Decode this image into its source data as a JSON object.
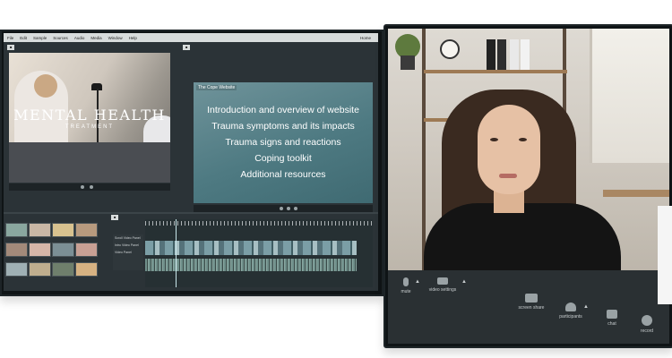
{
  "editor": {
    "menu": [
      "File",
      "Edit",
      "Sample",
      "Sources",
      "Audio",
      "Media",
      "Window",
      "Help"
    ],
    "home_label": "Home",
    "video_preview": {
      "title": "MENTAL HEALTH",
      "subtitle": "TREATMENT"
    },
    "slide": {
      "title": "The Cope Website",
      "items": [
        "Introduction and overview of website",
        "Trauma symptoms and its impacts",
        "Trauma signs and reactions",
        "Coping toolkit",
        "Additional resources"
      ]
    },
    "sequences": [
      "Scroll Video Panel",
      "Intro Video Panel",
      "Video Panel"
    ]
  },
  "call": {
    "toolbar": {
      "mute": "mute",
      "video_settings": "video settings",
      "screen_share": "screen share",
      "participants": "participants",
      "chat": "chat",
      "record": "record"
    }
  },
  "colors": {
    "editor_bg": "#2b3337",
    "slide_bg": "#4e7a82",
    "call_toolbar": "#2a3033"
  }
}
